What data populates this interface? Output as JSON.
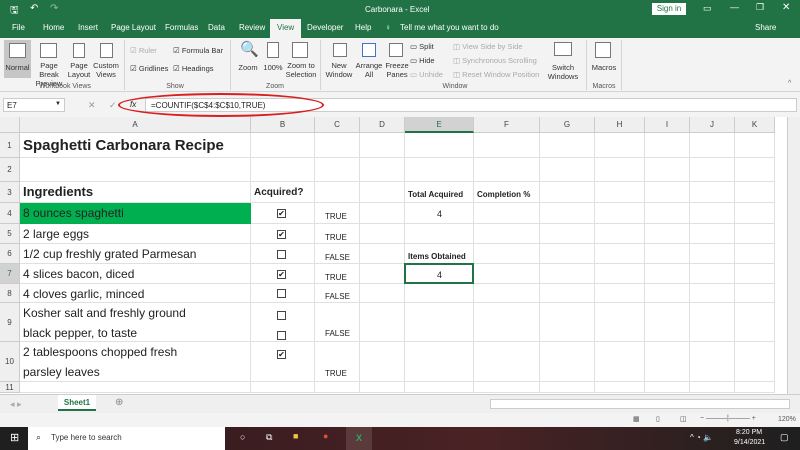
{
  "title": {
    "text": "Carbonara - Excel",
    "sign_in": "Sign in"
  },
  "tabs": [
    "File",
    "Home",
    "Insert",
    "Page Layout",
    "Formulas",
    "Data",
    "Review",
    "View",
    "Developer",
    "Help"
  ],
  "tell_me": "Tell me what you want to do",
  "share": "Share",
  "ribbon": {
    "normal": "Normal",
    "page_break": "Page Break Preview",
    "page_layout": "Page Layout",
    "custom_views": "Custom Views",
    "workbook_views": "Workbook Views",
    "ruler": "Ruler",
    "formula_bar": "Formula Bar",
    "gridlines": "Gridlines",
    "headings": "Headings",
    "show": "Show",
    "zoom": "Zoom",
    "zoom100": "100%",
    "zoom_sel": "Zoom to Selection",
    "zoom_group": "Zoom",
    "new_window": "New Window",
    "arrange_all": "Arrange All",
    "freeze": "Freeze Panes",
    "split": "Split",
    "hide": "Hide",
    "unhide": "Unhide",
    "side_by_side": "View Side by Side",
    "sync_scroll": "Synchronous Scrolling",
    "reset_pos": "Reset Window Position",
    "switch": "Switch Windows",
    "window": "Window",
    "macros": "Macros",
    "macros_group": "Macros"
  },
  "formula_bar": {
    "name_box": "E7",
    "fx": "fx",
    "formula": "=COUNTIF($C$4:$C$10,TRUE)"
  },
  "columns": [
    "A",
    "B",
    "C",
    "D",
    "E",
    "F",
    "G",
    "H",
    "I",
    "J",
    "K"
  ],
  "rows": [
    {
      "n": "1",
      "a": "Spaghetti Carbonara Recipe"
    },
    {
      "n": "2"
    },
    {
      "n": "3",
      "a": "Ingredients",
      "b": "Acquired?",
      "e": "Total Acquired",
      "f": "Completion %"
    },
    {
      "n": "4",
      "a": "8 ounces spaghetti",
      "checked": true,
      "c": "TRUE",
      "e": "4"
    },
    {
      "n": "5",
      "a": "2 large eggs",
      "checked": true,
      "c": "TRUE"
    },
    {
      "n": "6",
      "a": "1/2 cup freshly grated Parmesan",
      "checked": false,
      "c": "FALSE",
      "e": "Items Obtained"
    },
    {
      "n": "7",
      "a": "4 slices bacon, diced",
      "checked": true,
      "c": "TRUE",
      "e": "4"
    },
    {
      "n": "8",
      "a": "4 cloves garlic, minced",
      "checked": false,
      "c": "FALSE"
    },
    {
      "n": "9",
      "a": "Kosher salt and freshly ground",
      "a2": "black pepper, to taste",
      "checked": false,
      "checked2": false,
      "c": "FALSE"
    },
    {
      "n": "10",
      "a": "2 tablespoons chopped fresh",
      "a2": "parsley leaves",
      "checked": true,
      "c": "TRUE"
    },
    {
      "n": "11"
    }
  ],
  "sheet_tab": "Sheet1",
  "zoom_level": "120%",
  "taskbar": {
    "search": "Type here to search",
    "time": "8:20 PM",
    "date": "9/14/2021"
  },
  "colors": {
    "excel_green": "#217346",
    "highlight": "#00b050"
  }
}
